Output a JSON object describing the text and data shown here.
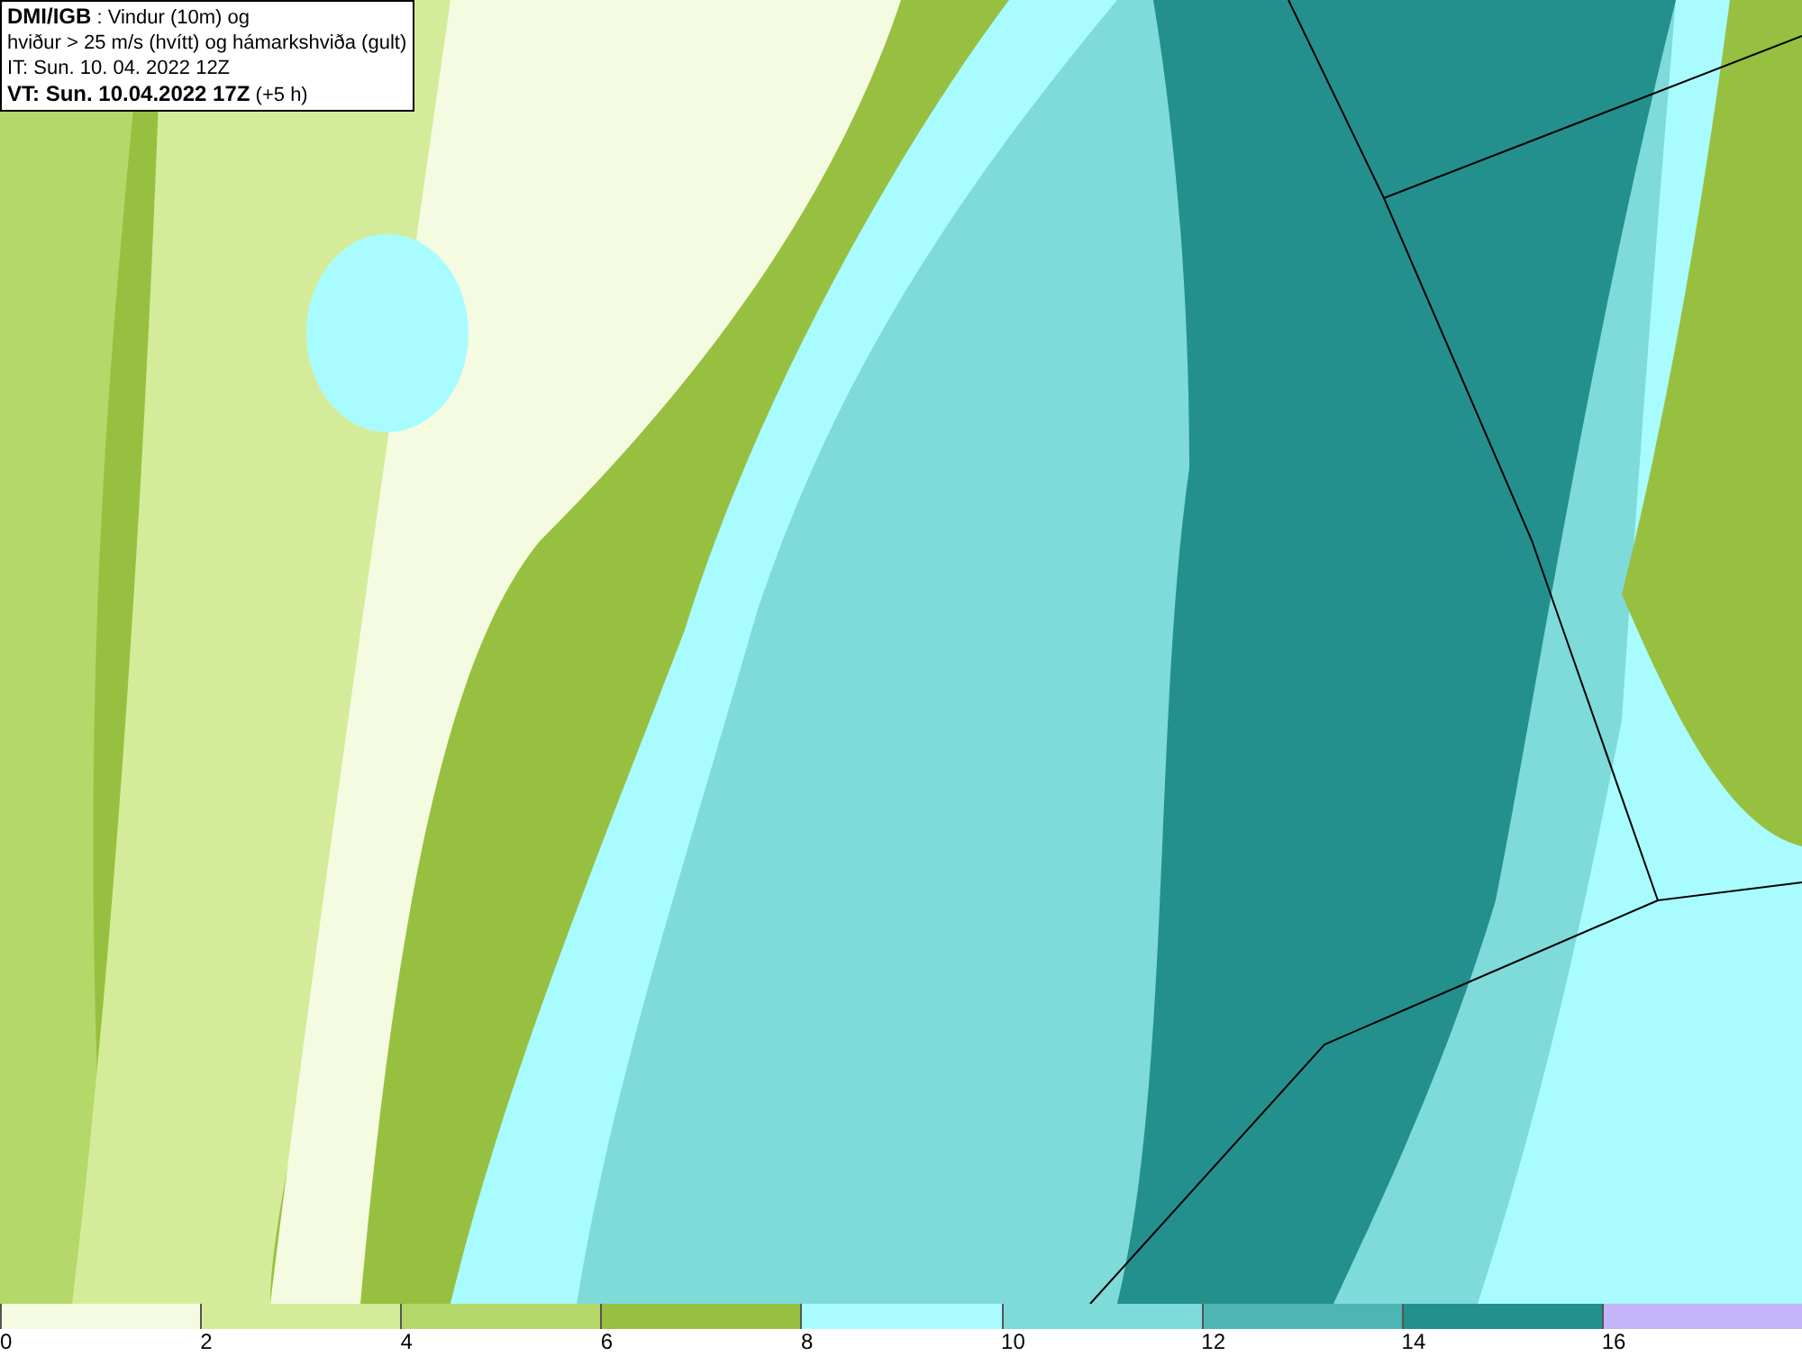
{
  "header": {
    "lines": [
      "**DMI/IGB** : Vindur (10m) og",
      "hviður > 25 m/s (hvítt) og hámarkshviða (gult)",
      "IT: Sun. 10. 04. 2022 12Z",
      "**VT: Sun. 10.04.2022 17Z** (+5 h)"
    ]
  },
  "legend": [
    {
      "color": "#f5fbe0",
      "label": "0"
    },
    {
      "color": "#d4ec9a",
      "label": "2"
    },
    {
      "color": "#b5d86a",
      "label": "4"
    },
    {
      "color": "#98c040",
      "label": "6"
    },
    {
      "color": "#a8fcff",
      "label": "8"
    },
    {
      "color": "#7fdada",
      "label": "10"
    },
    {
      "color": "#4fb4b4",
      "label": "12"
    },
    {
      "color": "#23908e",
      "label": "14"
    },
    {
      "color": "#c4b4fa",
      "label": "16"
    }
  ]
}
